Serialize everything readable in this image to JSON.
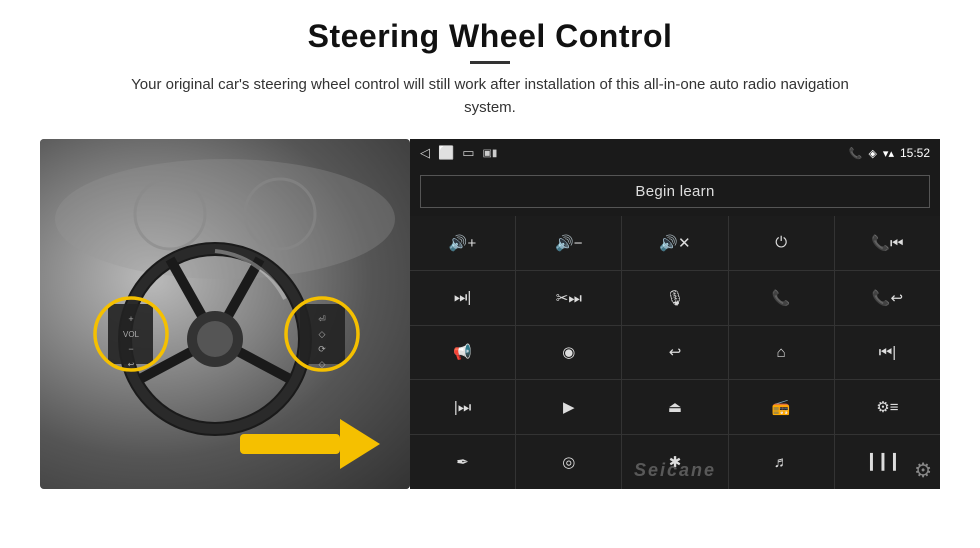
{
  "page": {
    "title": "Steering Wheel Control",
    "subtitle": "Your original car's steering wheel control will still work after installation of this all-in-one auto radio navigation system.",
    "divider": true
  },
  "statusbar": {
    "time": "15:52",
    "icons": [
      "phone",
      "location",
      "wifi",
      "battery"
    ]
  },
  "nav": {
    "back_icon": "◁",
    "home_icon": "⬜",
    "recent_icon": "▭",
    "media_icon": "▣"
  },
  "begin_learn": {
    "label": "Begin learn"
  },
  "controls": [
    {
      "icon": "🔊+",
      "name": "volume-up"
    },
    {
      "icon": "🔊−",
      "name": "volume-down"
    },
    {
      "icon": "🔇",
      "name": "mute"
    },
    {
      "icon": "⏻",
      "name": "power"
    },
    {
      "icon": "📞⏮",
      "name": "phone-prev"
    },
    {
      "icon": "⏭",
      "name": "next-track"
    },
    {
      "icon": "✂⏭",
      "name": "skip"
    },
    {
      "icon": "🎤",
      "name": "mic"
    },
    {
      "icon": "📞",
      "name": "phone"
    },
    {
      "icon": "📞↩",
      "name": "hang-up"
    },
    {
      "icon": "📢",
      "name": "horn"
    },
    {
      "icon": "360°",
      "name": "camera-360"
    },
    {
      "icon": "↩",
      "name": "back"
    },
    {
      "icon": "🏠",
      "name": "home"
    },
    {
      "icon": "⏮⏮",
      "name": "prev-track"
    },
    {
      "icon": "⏭⏭",
      "name": "fast-forward"
    },
    {
      "icon": "▶",
      "name": "navigate"
    },
    {
      "icon": "⏏",
      "name": "eject"
    },
    {
      "icon": "📻",
      "name": "radio"
    },
    {
      "icon": "⚙",
      "name": "equalizer"
    },
    {
      "icon": "🎤✏",
      "name": "voice-edit"
    },
    {
      "icon": "⊙",
      "name": "settings-circle"
    },
    {
      "icon": "✱",
      "name": "bluetooth"
    },
    {
      "icon": "🎵",
      "name": "music"
    },
    {
      "icon": "📊",
      "name": "spectrum"
    }
  ],
  "watermark": "Seicane",
  "gear_label": "⚙"
}
